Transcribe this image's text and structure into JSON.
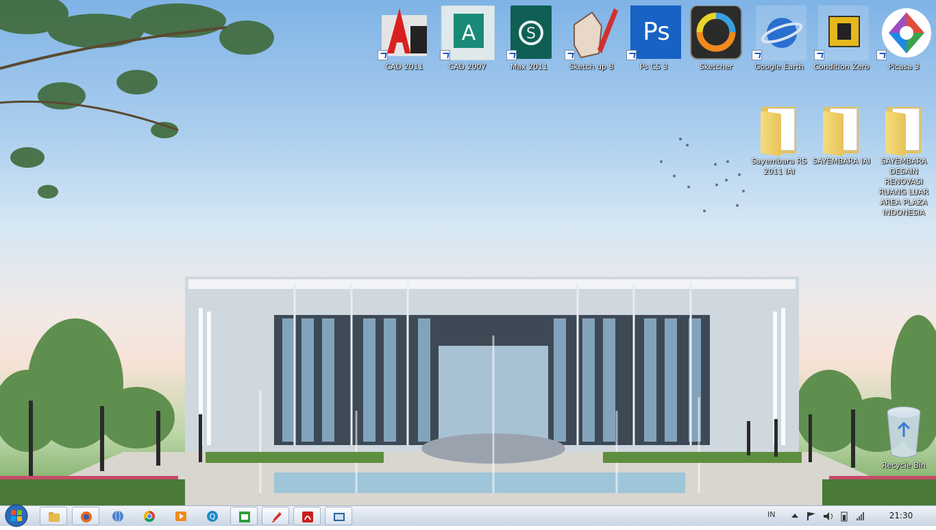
{
  "desktop_icons": [
    {
      "label": "CAD 2011",
      "icon": "autocad-2011-icon",
      "shortcut": true
    },
    {
      "label": "CAD 2007",
      "icon": "autocad-2007-icon",
      "shortcut": true
    },
    {
      "label": "Max 2011",
      "icon": "3ds-max-icon",
      "shortcut": true
    },
    {
      "label": "Sketch up 8",
      "icon": "sketchup-icon",
      "shortcut": true
    },
    {
      "label": "Ps CS 3",
      "icon": "photoshop-icon",
      "shortcut": true
    },
    {
      "label": "Sketcher",
      "icon": "sketcher-icon",
      "shortcut": false
    },
    {
      "label": "Google Earth",
      "icon": "google-earth-icon",
      "shortcut": true
    },
    {
      "label": "Condition Zero",
      "icon": "counter-strike-icon",
      "shortcut": true
    },
    {
      "label": "Picasa 3",
      "icon": "picasa-icon",
      "shortcut": true
    }
  ],
  "desktop_folders": [
    {
      "label": "Sayembara RS 2011 IAI"
    },
    {
      "label": "SAYEMBARA IAI"
    },
    {
      "label": "SAYEMBARA DESAIN RENOVASI RUANG LUAR AREA PLAZA INDONESIA"
    }
  ],
  "recycle_bin": {
    "label": "Recycle Bin"
  },
  "taskbar": {
    "start": "windows-start-orb",
    "items": [
      {
        "icon": "windows-explorer-icon",
        "pinned": true
      },
      {
        "icon": "firefox-icon",
        "pinned": true
      },
      {
        "icon": "internet-globe-icon",
        "pinned": false
      },
      {
        "icon": "chrome-icon",
        "pinned": false
      },
      {
        "icon": "media-player-icon",
        "pinned": false
      },
      {
        "icon": "q-app-icon",
        "pinned": false
      },
      {
        "icon": "spreadsheet-app-icon",
        "pinned": true
      },
      {
        "icon": "pencil-app-icon",
        "pinned": true
      },
      {
        "icon": "adobe-reader-icon",
        "pinned": true
      },
      {
        "icon": "screen-capture-icon",
        "pinned": true
      }
    ],
    "tray": {
      "language": "IN",
      "time": "21:30"
    }
  },
  "colors": {
    "folder": "#e8c35a",
    "shortcut_arrow": "#1a56c8"
  }
}
